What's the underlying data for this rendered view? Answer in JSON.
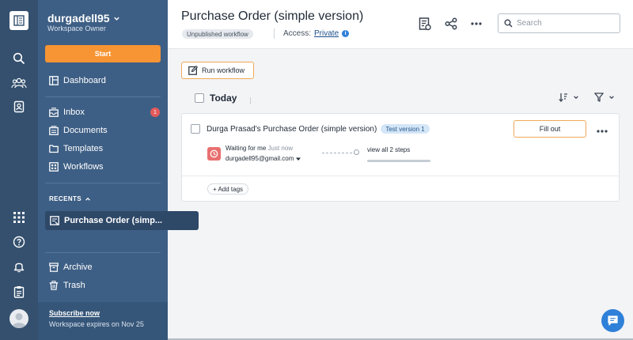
{
  "workspace": {
    "name": "durgadell95",
    "role": "Workspace Owner"
  },
  "sidebar": {
    "start_label": "Start",
    "items": [
      {
        "label": "Dashboard"
      },
      {
        "label": "Inbox",
        "badge": "1"
      },
      {
        "label": "Documents"
      },
      {
        "label": "Templates"
      },
      {
        "label": "Workflows"
      }
    ],
    "recents_header": "RECENTS",
    "recent_item": "Purchase Order (simp...",
    "archive_label": "Archive",
    "trash_label": "Trash",
    "subscribe_label": "Subscribe now",
    "expires_text": "Workspace expires on Nov 25"
  },
  "rail_icons": [
    "logo-icon",
    "search-icon",
    "team-icon",
    "contacts-icon",
    "apps-grid-icon",
    "help-icon",
    "bell-icon",
    "clipboard-icon",
    "avatar"
  ],
  "header": {
    "title": "Purchase Order (simple version)",
    "status_pill": "Unpublished workflow",
    "access_label": "Access:",
    "access_value": "Private",
    "search_placeholder": "Search"
  },
  "main": {
    "run_workflow_label": "Run workflow",
    "group_label": "Today",
    "card": {
      "title": "Durga Prasad's Purchase Order (simple version)",
      "version_pill": "Test version 1",
      "fill_out_label": "Fill out",
      "status": "Waiting for me",
      "time": "Just now",
      "email": "durgadell95@gmail.com",
      "steps_link": "view all 2 steps",
      "add_tags_label": "+ Add tags"
    }
  },
  "colors": {
    "rail": "#34506e",
    "sidebar": "#3e5f85",
    "accent_orange": "#f79433",
    "link_blue": "#1c4f8c",
    "chat_blue": "#2f80d9",
    "alert_red": "#e96f6f"
  }
}
